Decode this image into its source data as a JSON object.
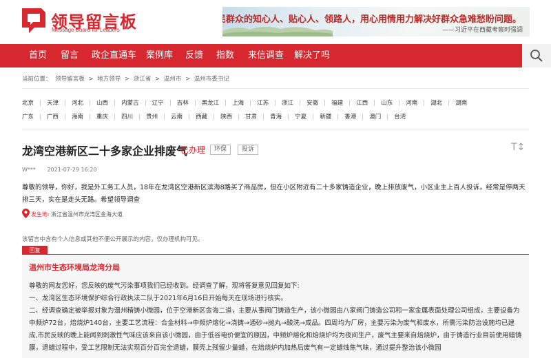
{
  "brand": {
    "name_cn": "领导留言板",
    "name_en": "Message Board for Leaders"
  },
  "banner": {
    "text": "当好人民群众的知心人、贴心人、领路人，用心用情用力解决好群众急难愁盼问题。",
    "signature": "——习近平在西藏考察时强调"
  },
  "nav": {
    "items": [
      "首页",
      "留言",
      "政企直通车",
      "案例库",
      "反馈",
      "指数",
      "来信调查",
      "解决了吗"
    ],
    "search_icon": "search-icon"
  },
  "breadcrumb": {
    "prefix": "当前位置：",
    "items": [
      "领导留言板",
      "地方领导",
      "浙江省",
      "温州市",
      "温州市委书记"
    ],
    "separator": ">"
  },
  "provinces": {
    "row1": [
      "北京",
      "天津",
      "河北",
      "山西",
      "内蒙古",
      "辽宁",
      "吉林",
      "黑龙江",
      "上海",
      "江苏",
      "浙江",
      "安徽",
      "福建",
      "江西",
      "山东",
      "河南",
      "湖北",
      "湖南"
    ],
    "row2": [
      "广东",
      "广西",
      "海南",
      "重庆",
      "四川",
      "贵州",
      "云南",
      "西藏",
      "陕西",
      "甘肃",
      "青海",
      "宁夏",
      "新疆",
      "香港",
      "澳门",
      "台湾"
    ]
  },
  "message": {
    "title": "龙湾空港新区二十多家企业排废气",
    "status": "已办理",
    "tags": [
      "环保",
      "投诉"
    ],
    "font_toggle": "T↕",
    "author": "W***",
    "time": "2021-07-29 16:20",
    "content": "尊敬的领导，你好，我是外工务工人员，18年在龙湾区空港新区滨海8路买了商品房，但在小区附近有二十多家铸造企业，晚上排放废气，小区业主上百人投诉，经常是停两天排三天，实在是走头无路。希望领导调查",
    "location_label": "发生地:",
    "location": "浙江省温州市龙湾区金海大道"
  },
  "privacy_note": "该留言中含有个人信息或其他不便公开展示的内容，仅办理机构可见。",
  "reply": {
    "tab_label": "回复",
    "org": "温州市生态环境局龙湾分局",
    "paragraphs": [
      "尊敬的网友您好，您反映的废气污染事项我们已经收到。经调查了解，现将答复意见回复如下:",
      "一、龙湾区生态环境保护综合行政执法二队于2021年6月16日开始每天在现场进行核实。",
      "二、经调查确定被举报对象为温州精铸小微园，位于空港新区金海二道，主要从事阀门铸造生产，该小微园由八家阀门铸造公司和一家金属表面处理公司组成，主要设备为中频炉72台，焙烧炉140台，主要工艺流程：合金材料→中频炉熔化→浇铸→通砂→抛丸→酸洗→成品。四周均为厂房，主要污染为废气和废水，所需污染防治设施均已建成,市民反映的晚上能闻到刺激性气味应该来自该小微园，由于低谷电价便宜的原因，中频炉熔化和焙烧炉均为夜间生产，废气主要来自焙烧炉，由于铸造行业目前使用蜡铸膜，退蜡过程中，受工艺限制无法实现百分百完全退蜡，膜壳上残留少量蜡，在焙烧炉内加热后废气有一定蜡烛焦气味，通过提升整治该小微园"
    ]
  },
  "colors": {
    "brand_red": "#d7282f",
    "reply_bg": "#f6f6f6"
  }
}
